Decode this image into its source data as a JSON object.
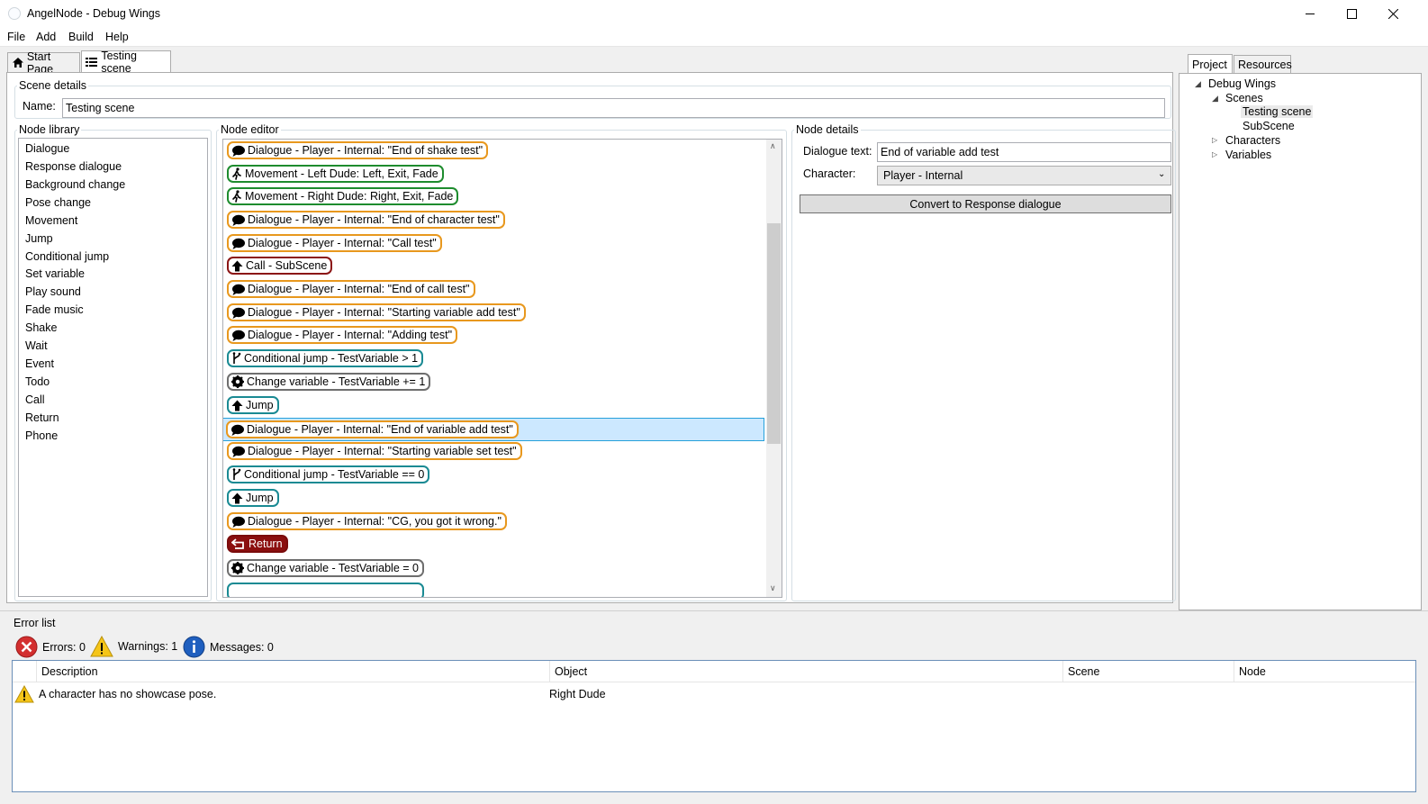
{
  "window": {
    "title": "AngelNode - Debug Wings"
  },
  "menu": [
    "File",
    "Add",
    "Build",
    "Help"
  ],
  "tabs": [
    {
      "label": "Start Page",
      "icon": "home-icon",
      "active": false
    },
    {
      "label": "Testing scene",
      "icon": "list-icon",
      "active": true
    }
  ],
  "scene_details": {
    "legend": "Scene details",
    "name_label": "Name:",
    "name_value": "Testing scene"
  },
  "node_library": {
    "legend": "Node library",
    "items": [
      "Dialogue",
      "Response dialogue",
      "Background change",
      "Pose change",
      "Movement",
      "Jump",
      "Conditional jump",
      "Set variable",
      "Play sound",
      "Fade music",
      "Shake",
      "Wait",
      "Event",
      "Todo",
      "Call",
      "Return",
      "Phone"
    ]
  },
  "node_editor": {
    "legend": "Node editor",
    "nodes": [
      {
        "type": "dialogue",
        "text": "Dialogue - Player - Internal: \"End of shake test\""
      },
      {
        "type": "movement",
        "text": "Movement - Left Dude: Left, Exit, Fade"
      },
      {
        "type": "movement",
        "text": "Movement - Right Dude: Right, Exit, Fade"
      },
      {
        "type": "dialogue",
        "text": "Dialogue - Player - Internal: \"End of character test\""
      },
      {
        "type": "dialogue",
        "text": "Dialogue - Player - Internal: \"Call test\""
      },
      {
        "type": "call",
        "text": "Call - SubScene"
      },
      {
        "type": "dialogue",
        "text": "Dialogue - Player - Internal: \"End of call test\""
      },
      {
        "type": "dialogue",
        "text": "Dialogue - Player - Internal: \"Starting variable add test\""
      },
      {
        "type": "dialogue",
        "text": "Dialogue - Player - Internal: \"Adding test\""
      },
      {
        "type": "conditional",
        "text": "Conditional jump - TestVariable > 1"
      },
      {
        "type": "variable",
        "text": "Change variable - TestVariable += 1"
      },
      {
        "type": "jump",
        "text": "Jump"
      },
      {
        "type": "dialogue",
        "text": "Dialogue - Player - Internal: \"End of variable add test\"",
        "selected": true
      },
      {
        "type": "dialogue",
        "text": "Dialogue - Player - Internal: \"Starting variable set test\""
      },
      {
        "type": "conditional",
        "text": "Conditional jump - TestVariable == 0"
      },
      {
        "type": "jump",
        "text": "Jump"
      },
      {
        "type": "dialogue",
        "text": "Dialogue - Player - Internal: \"CG, you got it wrong.\""
      },
      {
        "type": "return",
        "text": "Return"
      },
      {
        "type": "variable",
        "text": "Change variable - TestVariable = 0"
      }
    ]
  },
  "node_details": {
    "legend": "Node details",
    "dialogue_text_label": "Dialogue text:",
    "dialogue_text_value": "End of variable add test",
    "character_label": "Character:",
    "character_value": "Player - Internal",
    "convert_button": "Convert to Response dialogue"
  },
  "project_panel": {
    "tabs": [
      "Project",
      "Resources"
    ],
    "tree": {
      "root": "Debug Wings",
      "scenes_label": "Scenes",
      "scenes": [
        "Testing scene",
        "SubScene"
      ],
      "characters_label": "Characters",
      "variables_label": "Variables"
    }
  },
  "error_list": {
    "title": "Error list",
    "errors_label": "Errors: 0",
    "warnings_label": "Warnings: 1",
    "messages_label": "Messages: 0",
    "columns": [
      "Description",
      "Object",
      "Scene",
      "Node"
    ],
    "rows": [
      {
        "description": "A character has no showcase pose.",
        "object": "Right Dude",
        "scene": "",
        "node": ""
      }
    ]
  },
  "colors": {
    "dialogue": "#e8981e",
    "movement": "#1e8c2e",
    "call": "#8b1515",
    "conditional": "#1a8a93",
    "variable": "#6e6e6e",
    "return": "#8b0f0f",
    "selection": "#cce8ff"
  }
}
